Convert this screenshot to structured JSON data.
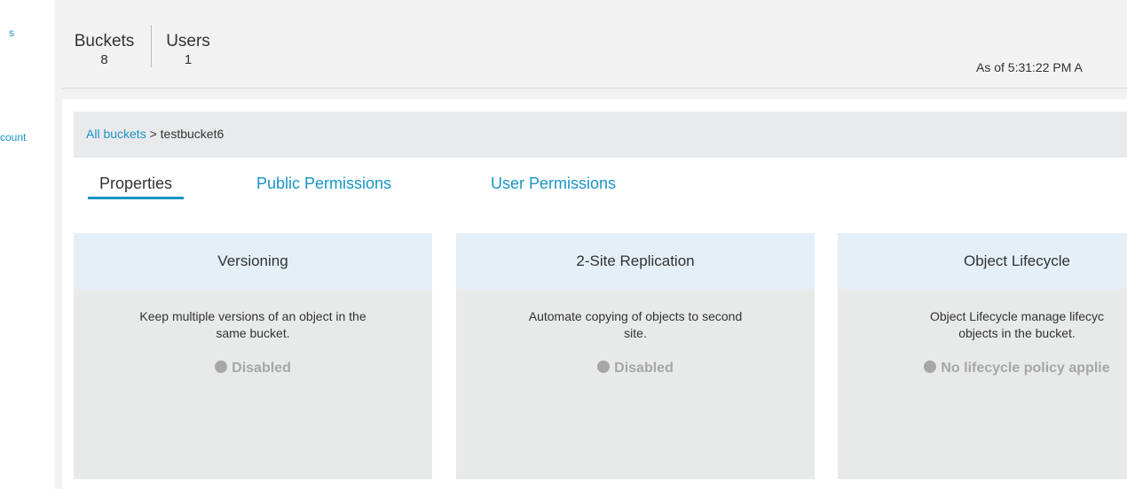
{
  "sidebar": {
    "items": [
      {
        "label": "s"
      },
      {
        "label": "count"
      }
    ]
  },
  "stats": {
    "buckets_label": "Buckets",
    "buckets_value": "8",
    "users_label": "Users",
    "users_value": "1",
    "as_of": "As of 5:31:22 PM A"
  },
  "breadcrumb": {
    "link": "All buckets",
    "separator": ">",
    "current": "testbucket6"
  },
  "tabs": [
    {
      "label": "Properties",
      "active": true
    },
    {
      "label": "Public Permissions",
      "active": false
    },
    {
      "label": "User Permissions",
      "active": false
    }
  ],
  "cards": [
    {
      "title": "Versioning",
      "desc_line1": "Keep multiple versions of an object in the",
      "desc_line2": "same bucket.",
      "status": "Disabled"
    },
    {
      "title": "2-Site Replication",
      "desc_line1": "Automate copying of objects to second",
      "desc_line2": "site.",
      "status": "Disabled"
    },
    {
      "title": "Object Lifecycle",
      "desc_line1": "Object Lifecycle manage lifecyc",
      "desc_line2": "objects in the bucket.",
      "status": "No lifecycle policy applie"
    }
  ],
  "colors": {
    "accent": "#1a94c6",
    "card_header": "#e4eff7",
    "card_body": "#e8e9e9",
    "status_grey": "#a7a7a7"
  }
}
